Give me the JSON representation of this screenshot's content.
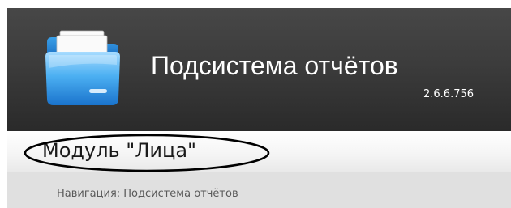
{
  "header": {
    "title": "Подсистема отчётов",
    "version": "2.6.6.756",
    "logo_icon": "folder-icon",
    "background_color": "#3c3c3c"
  },
  "module": {
    "title": "Модуль \"Лица\"",
    "highlight": "ellipse-annotation"
  },
  "navigation": {
    "breadcrumb": "Навигация: Подсистема отчётов"
  }
}
